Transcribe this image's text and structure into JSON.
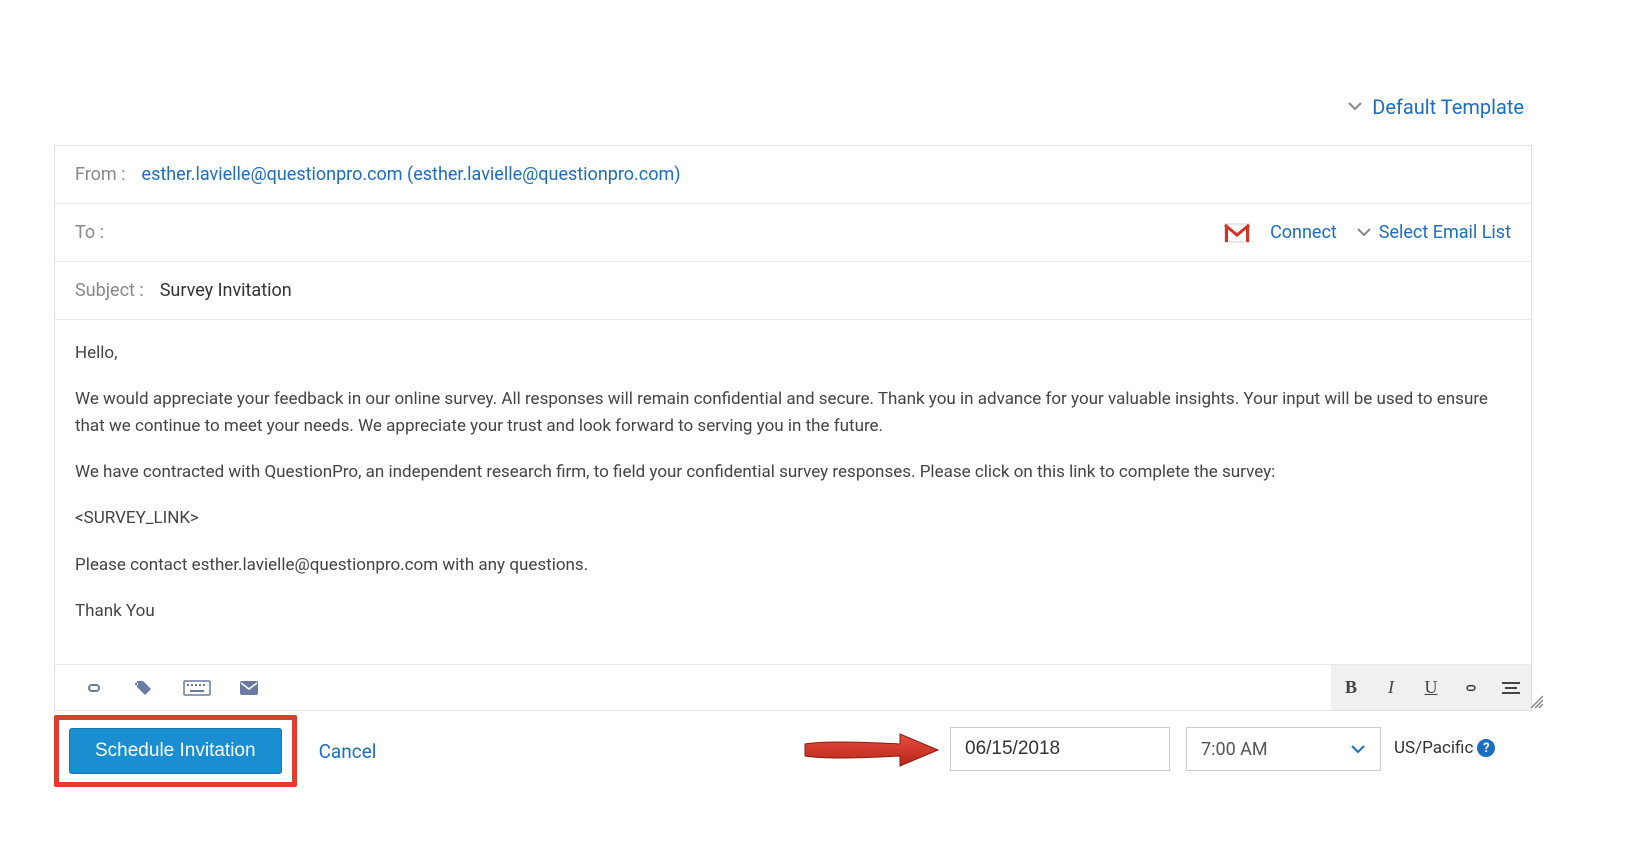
{
  "template_dropdown": {
    "label": "Default Template"
  },
  "from": {
    "label": "From :",
    "value": "esther.lavielle@questionpro.com (esther.lavielle@questionpro.com)"
  },
  "to": {
    "label": "To :",
    "connect": "Connect",
    "select_list": "Select Email List"
  },
  "subject": {
    "label": "Subject :",
    "value": "Survey Invitation"
  },
  "body": {
    "greeting": "Hello,",
    "p1": "We would appreciate your feedback in our online survey.  All responses will remain confidential and secure.  Thank you in advance for your valuable insights.  Your input will be used to ensure that we continue to meet your needs. We appreciate your trust and look forward to serving you in the future.",
    "p2": "We have contracted with QuestionPro, an independent research firm, to field your confidential survey responses.  Please click on this link to complete the survey:",
    "link_placeholder": "<SURVEY_LINK>",
    "p3": "Please contact esther.lavielle@questionpro.com with any questions.",
    "closing": "Thank You"
  },
  "format_toolbar": {
    "bold": "B",
    "italic": "I",
    "underline": "U"
  },
  "actions": {
    "schedule": "Schedule Invitation",
    "cancel": "Cancel"
  },
  "schedule": {
    "date": "06/15/2018",
    "time": "7:00 AM",
    "timezone": "US/Pacific"
  }
}
